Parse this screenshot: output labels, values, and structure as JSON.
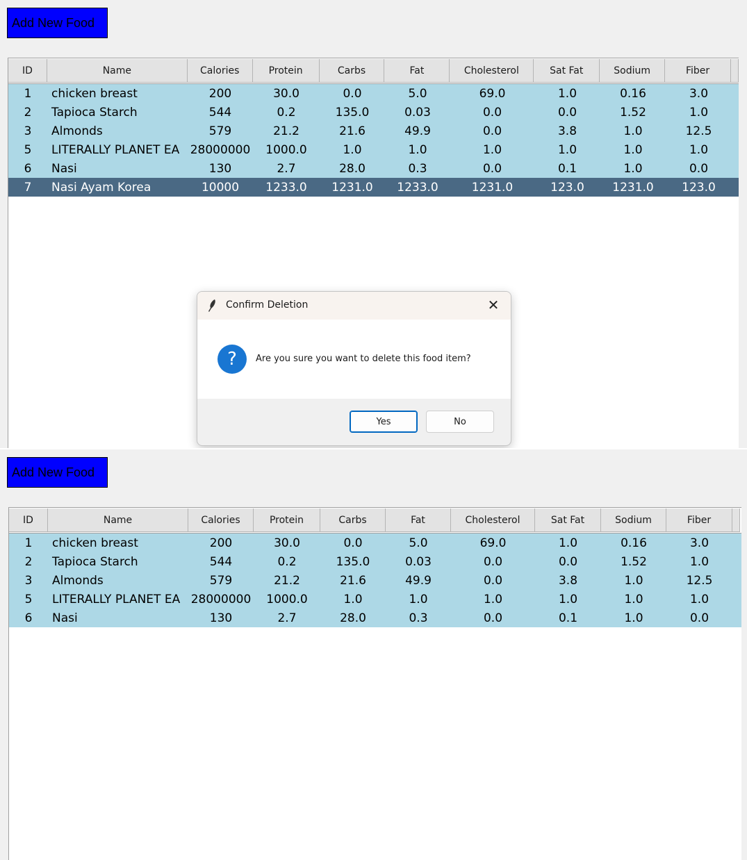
{
  "add_button_label": "Add New Food",
  "columns": [
    "ID",
    "Name",
    "Calories",
    "Protein",
    "Carbs",
    "Fat",
    "Cholesterol",
    "Sat Fat",
    "Sodium",
    "Fiber"
  ],
  "top_table": {
    "rows": [
      [
        "1",
        "chicken breast",
        "200",
        "30.0",
        "0.0",
        "5.0",
        "69.0",
        "1.0",
        "0.16",
        "3.0"
      ],
      [
        "2",
        "Tapioca Starch",
        "544",
        "0.2",
        "135.0",
        "0.03",
        "0.0",
        "0.0",
        "1.52",
        "1.0"
      ],
      [
        "3",
        "Almonds",
        "579",
        "21.2",
        "21.6",
        "49.9",
        "0.0",
        "3.8",
        "1.0",
        "12.5"
      ],
      [
        "5",
        "LITERALLY PLANET EA",
        "28000000",
        "1000.0",
        "1.0",
        "1.0",
        "1.0",
        "1.0",
        "1.0",
        "1.0"
      ],
      [
        "6",
        "Nasi",
        "130",
        "2.7",
        "28.0",
        "0.3",
        "0.0",
        "0.1",
        "1.0",
        "0.0"
      ],
      [
        "7",
        "Nasi Ayam Korea",
        "10000",
        "1233.0",
        "1231.0",
        "1233.0",
        "1231.0",
        "123.0",
        "1231.0",
        "123.0"
      ]
    ],
    "selected_row": 5
  },
  "bottom_table": {
    "rows": [
      [
        "1",
        "chicken breast",
        "200",
        "30.0",
        "0.0",
        "5.0",
        "69.0",
        "1.0",
        "0.16",
        "3.0"
      ],
      [
        "2",
        "Tapioca Starch",
        "544",
        "0.2",
        "135.0",
        "0.03",
        "0.0",
        "0.0",
        "1.52",
        "1.0"
      ],
      [
        "3",
        "Almonds",
        "579",
        "21.2",
        "21.6",
        "49.9",
        "0.0",
        "3.8",
        "1.0",
        "12.5"
      ],
      [
        "5",
        "LITERALLY PLANET EA",
        "28000000",
        "1000.0",
        "1.0",
        "1.0",
        "1.0",
        "1.0",
        "1.0",
        "1.0"
      ],
      [
        "6",
        "Nasi",
        "130",
        "2.7",
        "28.0",
        "0.3",
        "0.0",
        "0.1",
        "1.0",
        "0.0"
      ]
    ]
  },
  "dialog": {
    "title": "Confirm Deletion",
    "message": "Are you sure you want to delete this food item?",
    "yes_label": "Yes",
    "no_label": "No",
    "close_glyph": "✕",
    "question_glyph": "?",
    "icons": [
      "feather-icon",
      "question-icon",
      "close-icon"
    ]
  },
  "colors": {
    "add_button_bg": "#0000ff",
    "row_bg": "#add8e6",
    "selected_row_bg": "#4a6984",
    "question_icon": "#1976d2",
    "default_button_border": "#0067c0"
  }
}
